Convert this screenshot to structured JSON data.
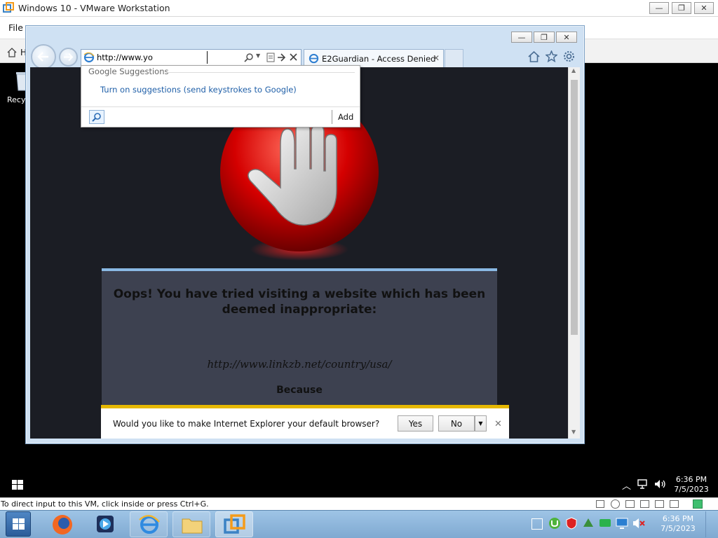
{
  "vmware": {
    "title": "Windows 10 - VMware Workstation",
    "menu_file": "File",
    "tab_partial": "H",
    "status_text": "To direct input to this VM, click inside or press Ctrl+G."
  },
  "desktop": {
    "recycle_partial": "Recy"
  },
  "ie": {
    "address_value": "http://www.yo",
    "tab_title": "E2Guardian - Access Denied",
    "suggestions_header": "Google Suggestions",
    "suggestions_link": "Turn on suggestions (send keystrokes to Google)",
    "add_label": "Add",
    "icons": {
      "back": "back-arrow-icon",
      "forward": "forward-arrow-icon",
      "home": "home-icon",
      "favorites": "star-icon",
      "tools": "gear-icon"
    }
  },
  "blockpage": {
    "message": "Oops! You have tried visiting a website which has been deemed inappropriate:",
    "url": "http://www.linkzb.net/country/usa/",
    "because": "Because"
  },
  "notification": {
    "question": "Would you like to make Internet Explorer your default browser?",
    "yes": "Yes",
    "no": "No"
  },
  "guest_clock": {
    "time": "6:36 PM",
    "date": "7/5/2023"
  },
  "host_clock": {
    "time": "6:36 PM",
    "date": "7/5/2023"
  },
  "colors": {
    "notification_bar": "#e6b800",
    "stop_sign_red": "#d40000",
    "link_blue": "#1f5fa8",
    "host_taskbar": "#8fb8dd"
  }
}
